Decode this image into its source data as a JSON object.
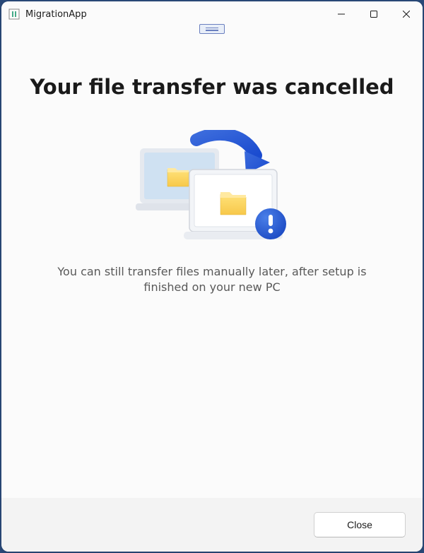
{
  "titlebar": {
    "app_name": "MigrationApp"
  },
  "content": {
    "headline": "Your file transfer was cancelled",
    "subtext": "You can still transfer files manually later, after setup is finished on your new PC"
  },
  "footer": {
    "close_label": "Close"
  }
}
